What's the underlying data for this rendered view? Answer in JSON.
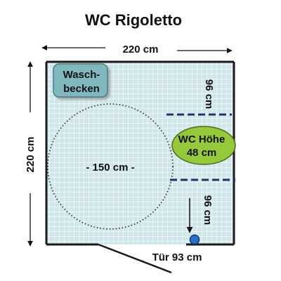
{
  "title": "WC Rigoletto",
  "width_label": "220 cm",
  "height_label": "220 cm",
  "sink_label_line1": "Wasch-",
  "sink_label_line2": "becken",
  "circle_label": "- 150 cm -",
  "wc_label_line1": "WC Höhe",
  "wc_label_line2": "48 cm",
  "gap_top_label": "96 cm",
  "gap_bottom_label": "96 cm",
  "door_label": "Tür  93 cm",
  "colors": {
    "floor": "#cfe7ea",
    "grid": "#ffffff",
    "wall": "#1a1a1a",
    "sink_fill": "#7fb8bd",
    "wc_fill": "#96c93a",
    "dash_line": "#1f2f7a",
    "marker": "#2a6fc9"
  }
}
